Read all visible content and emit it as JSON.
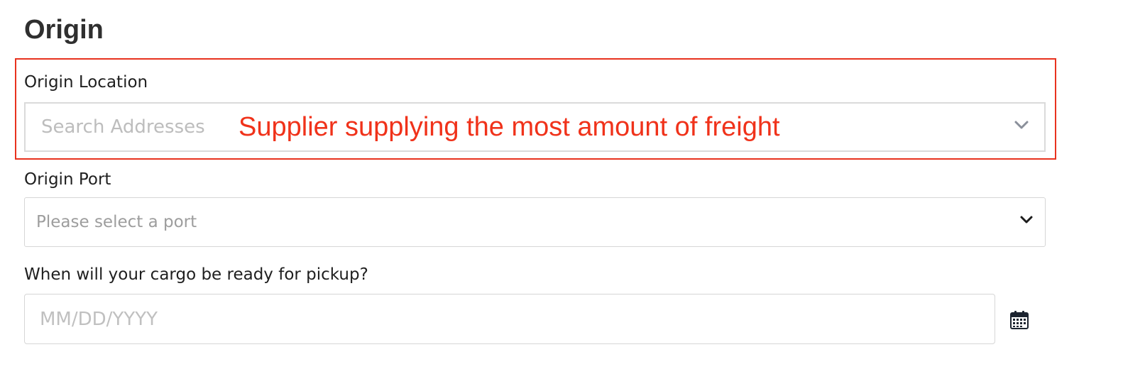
{
  "section": {
    "title": "Origin"
  },
  "origin_location": {
    "label": "Origin Location",
    "placeholder": "Search Addresses",
    "annotation": "Supplier supplying the most amount of freight"
  },
  "origin_port": {
    "label": "Origin Port",
    "placeholder": "Please select a port"
  },
  "pickup_date": {
    "label": "When will your cargo be ready for pickup?",
    "placeholder": "MM/DD/YYYY"
  },
  "icons": {
    "location_dropdown": "chevron-down-icon",
    "port_dropdown": "chevron-down-icon",
    "date_picker": "calendar-icon"
  },
  "colors": {
    "annotation": "#e8321e",
    "title": "#2f2f2f",
    "placeholder": "#b4b4b4",
    "border": "#d6d6d6"
  }
}
